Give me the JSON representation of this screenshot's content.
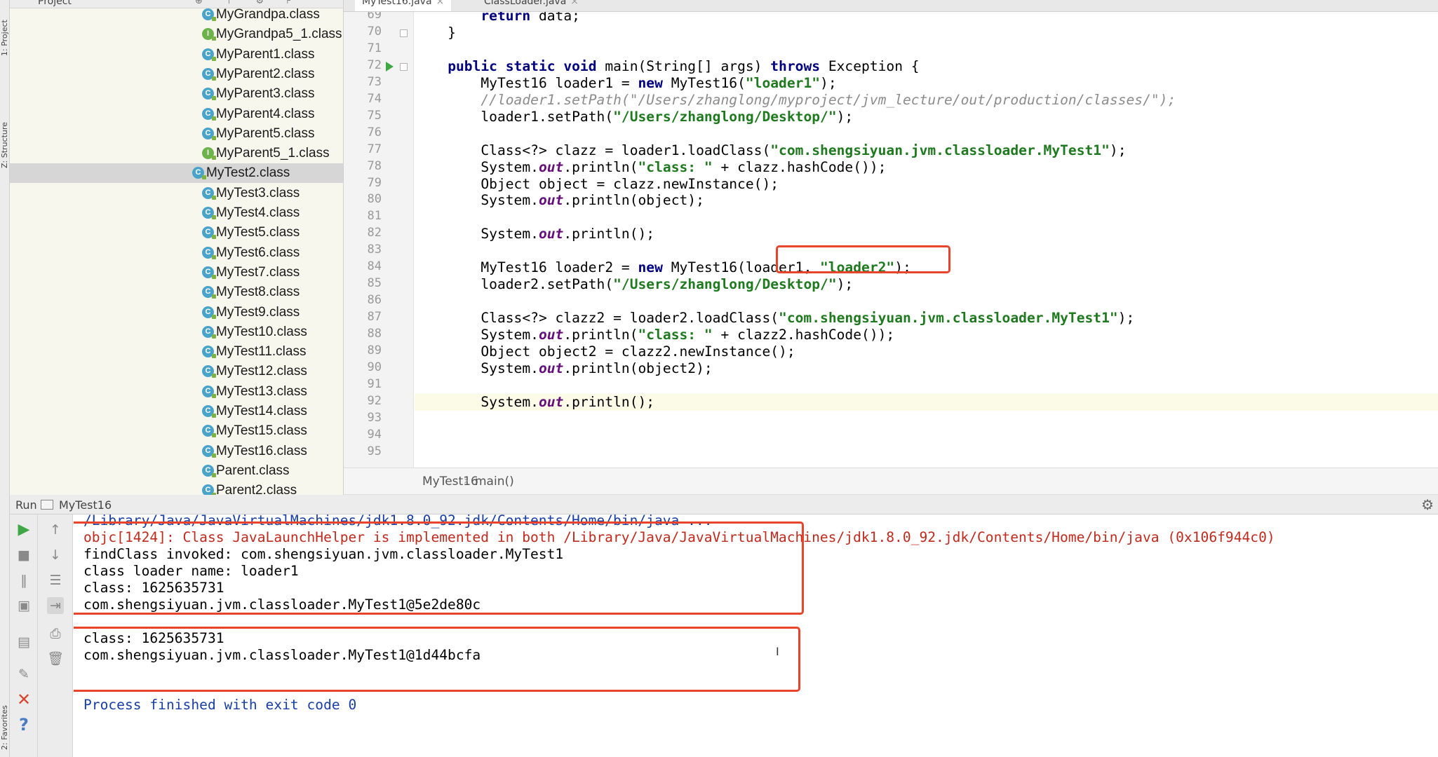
{
  "side_labels": {
    "project": "1: Project",
    "structure": "Z: Structure",
    "favorites": "2: Favorites"
  },
  "project_panel": {
    "title": "Project",
    "header_tools": "⊕ ⊤ ⚙ ⊦",
    "items": [
      {
        "label": "MyGrandpa.class",
        "kind": "class"
      },
      {
        "label": "MyGrandpa5_1.class",
        "kind": "interface"
      },
      {
        "label": "MyParent1.class",
        "kind": "class"
      },
      {
        "label": "MyParent2.class",
        "kind": "class"
      },
      {
        "label": "MyParent3.class",
        "kind": "class"
      },
      {
        "label": "MyParent4.class",
        "kind": "class"
      },
      {
        "label": "MyParent5.class",
        "kind": "class"
      },
      {
        "label": "MyParent5_1.class",
        "kind": "interface"
      },
      {
        "label": "MyTest2.class",
        "kind": "class",
        "selected": true
      },
      {
        "label": "MyTest3.class",
        "kind": "class"
      },
      {
        "label": "MyTest4.class",
        "kind": "class"
      },
      {
        "label": "MyTest5.class",
        "kind": "class"
      },
      {
        "label": "MyTest6.class",
        "kind": "class"
      },
      {
        "label": "MyTest7.class",
        "kind": "class"
      },
      {
        "label": "MyTest8.class",
        "kind": "class"
      },
      {
        "label": "MyTest9.class",
        "kind": "class"
      },
      {
        "label": "MyTest10.class",
        "kind": "class"
      },
      {
        "label": "MyTest11.class",
        "kind": "class"
      },
      {
        "label": "MyTest12.class",
        "kind": "class"
      },
      {
        "label": "MyTest13.class",
        "kind": "class"
      },
      {
        "label": "MyTest14.class",
        "kind": "class"
      },
      {
        "label": "MyTest15.class",
        "kind": "class"
      },
      {
        "label": "MyTest16.class",
        "kind": "class"
      },
      {
        "label": "Parent.class",
        "kind": "class"
      },
      {
        "label": "Parent2.class",
        "kind": "class"
      }
    ]
  },
  "tabs": [
    {
      "label": "MyTest16.java",
      "active": true,
      "close": "×"
    },
    {
      "label": "ClassLoader.java",
      "active": false,
      "close": "×"
    }
  ],
  "editor": {
    "line_numbers": [
      "69",
      "70",
      "71",
      "72",
      "73",
      "74",
      "75",
      "76",
      "77",
      "78",
      "79",
      "80",
      "81",
      "82",
      "83",
      "84",
      "85",
      "86",
      "87",
      "88",
      "89",
      "90",
      "91",
      "92",
      "93",
      "94",
      "95"
    ],
    "current_line": "92",
    "run_marker_line": "72",
    "lines": [
      [
        {
          "t": "        "
        },
        {
          "t": "return",
          "s": "kw"
        },
        {
          "t": " data;"
        }
      ],
      [
        {
          "t": "    }"
        }
      ],
      [],
      [
        {
          "t": "    "
        },
        {
          "t": "public static void",
          "s": "kw"
        },
        {
          "t": " main(String[] args) "
        },
        {
          "t": "throws",
          "s": "kw"
        },
        {
          "t": " Exception {"
        }
      ],
      [
        {
          "t": "        MyTest16 loader1 = "
        },
        {
          "t": "new",
          "s": "kw"
        },
        {
          "t": " MyTest16("
        },
        {
          "t": "\"loader1\"",
          "s": "str"
        },
        {
          "t": ");"
        }
      ],
      [
        {
          "t": "        "
        },
        {
          "t": "//loader1.setPath(\"/Users/zhanglong/myproject/jvm_lecture/out/production/classes/\");",
          "s": "cmt"
        }
      ],
      [
        {
          "t": "        loader1.setPath("
        },
        {
          "t": "\"/Users/zhanglong/Desktop/\"",
          "s": "str"
        },
        {
          "t": ");"
        }
      ],
      [],
      [
        {
          "t": "        Class<?> clazz = loader1.loadClass("
        },
        {
          "t": "\"com.shengsiyuan.jvm.classloader.MyTest1\"",
          "s": "str"
        },
        {
          "t": ");"
        }
      ],
      [
        {
          "t": "        System."
        },
        {
          "t": "out",
          "s": "fld"
        },
        {
          "t": ".println("
        },
        {
          "t": "\"class: \"",
          "s": "str"
        },
        {
          "t": " + clazz.hashCode());"
        }
      ],
      [
        {
          "t": "        Object object = clazz.newInstance();"
        }
      ],
      [
        {
          "t": "        System."
        },
        {
          "t": "out",
          "s": "fld"
        },
        {
          "t": ".println(object);"
        }
      ],
      [],
      [
        {
          "t": "        System."
        },
        {
          "t": "out",
          "s": "fld"
        },
        {
          "t": ".println();"
        }
      ],
      [],
      [
        {
          "t": "        MyTest16 loader2 = "
        },
        {
          "t": "new",
          "s": "kw"
        },
        {
          "t": " MyTest16(loader1, "
        },
        {
          "t": "\"loader2\"",
          "s": "str"
        },
        {
          "t": ");"
        }
      ],
      [
        {
          "t": "        loader2.setPath("
        },
        {
          "t": "\"/Users/zhanglong/Desktop/\"",
          "s": "str"
        },
        {
          "t": ");"
        }
      ],
      [],
      [
        {
          "t": "        Class<?> clazz2 = loader2.loadClass("
        },
        {
          "t": "\"com.shengsiyuan.jvm.classloader.MyTest1\"",
          "s": "str"
        },
        {
          "t": ");"
        }
      ],
      [
        {
          "t": "        System."
        },
        {
          "t": "out",
          "s": "fld"
        },
        {
          "t": ".println("
        },
        {
          "t": "\"class: \"",
          "s": "str"
        },
        {
          "t": " + clazz2.hashCode());"
        }
      ],
      [
        {
          "t": "        Object object2 = clazz2.newInstance();"
        }
      ],
      [
        {
          "t": "        System."
        },
        {
          "t": "out",
          "s": "fld"
        },
        {
          "t": ".println(object2);"
        }
      ],
      [],
      [
        {
          "t": "        System."
        },
        {
          "t": "out",
          "s": "fld"
        },
        {
          "t": ".println();"
        }
      ],
      [],
      [],
      []
    ]
  },
  "breadcrumb": {
    "class_name": "MyTest16",
    "separator": "›",
    "method": "main()"
  },
  "run_panel": {
    "tab_label": "Run",
    "config_name": "MyTest16",
    "gear": "⚙",
    "console_lines": [
      {
        "text": "/Library/Java/JavaVirtualMachines/jdk1.8.0_92.jdk/Contents/Home/bin/java ...",
        "style": "cmd"
      },
      {
        "text": "objc[1424]: Class JavaLaunchHelper is implemented in both /Library/Java/JavaVirtualMachines/jdk1.8.0_92.jdk/Contents/Home/bin/java (0x106f944c0)",
        "style": "err"
      },
      {
        "text": "findClass invoked: com.shengsiyuan.jvm.classloader.MyTest1",
        "style": "out"
      },
      {
        "text": "class loader name: loader1",
        "style": "out"
      },
      {
        "text": "class: 1625635731",
        "style": "out"
      },
      {
        "text": "com.shengsiyuan.jvm.classloader.MyTest1@5e2de80c",
        "style": "out"
      },
      {
        "text": "",
        "style": "out"
      },
      {
        "text": "class: 1625635731",
        "style": "out"
      },
      {
        "text": "com.shengsiyuan.jvm.classloader.MyTest1@1d44bcfa",
        "style": "out"
      },
      {
        "text": "",
        "style": "out"
      },
      {
        "text": "",
        "style": "out"
      },
      {
        "text": "Process finished with exit code 0",
        "style": "finish"
      }
    ]
  },
  "colors": {
    "highlight_box": "#e8432b",
    "keyword": "#000080",
    "string": "#1f7a1f",
    "error_text": "#c02a1d",
    "run_green": "#3fa845"
  },
  "icons": {
    "run": "run-icon",
    "stop": "stop-icon",
    "pause": "pause-icon",
    "dump": "dump-threads-icon",
    "up": "up-arrow-icon",
    "down": "down-arrow-icon",
    "wrap": "soft-wrap-icon",
    "scroll": "scroll-to-end-icon",
    "print": "print-icon",
    "trash": "clear-all-icon",
    "layout": "layout-icon",
    "pin": "pin-icon",
    "close": "close-icon",
    "help": "help-icon",
    "gear": "gear-icon"
  }
}
